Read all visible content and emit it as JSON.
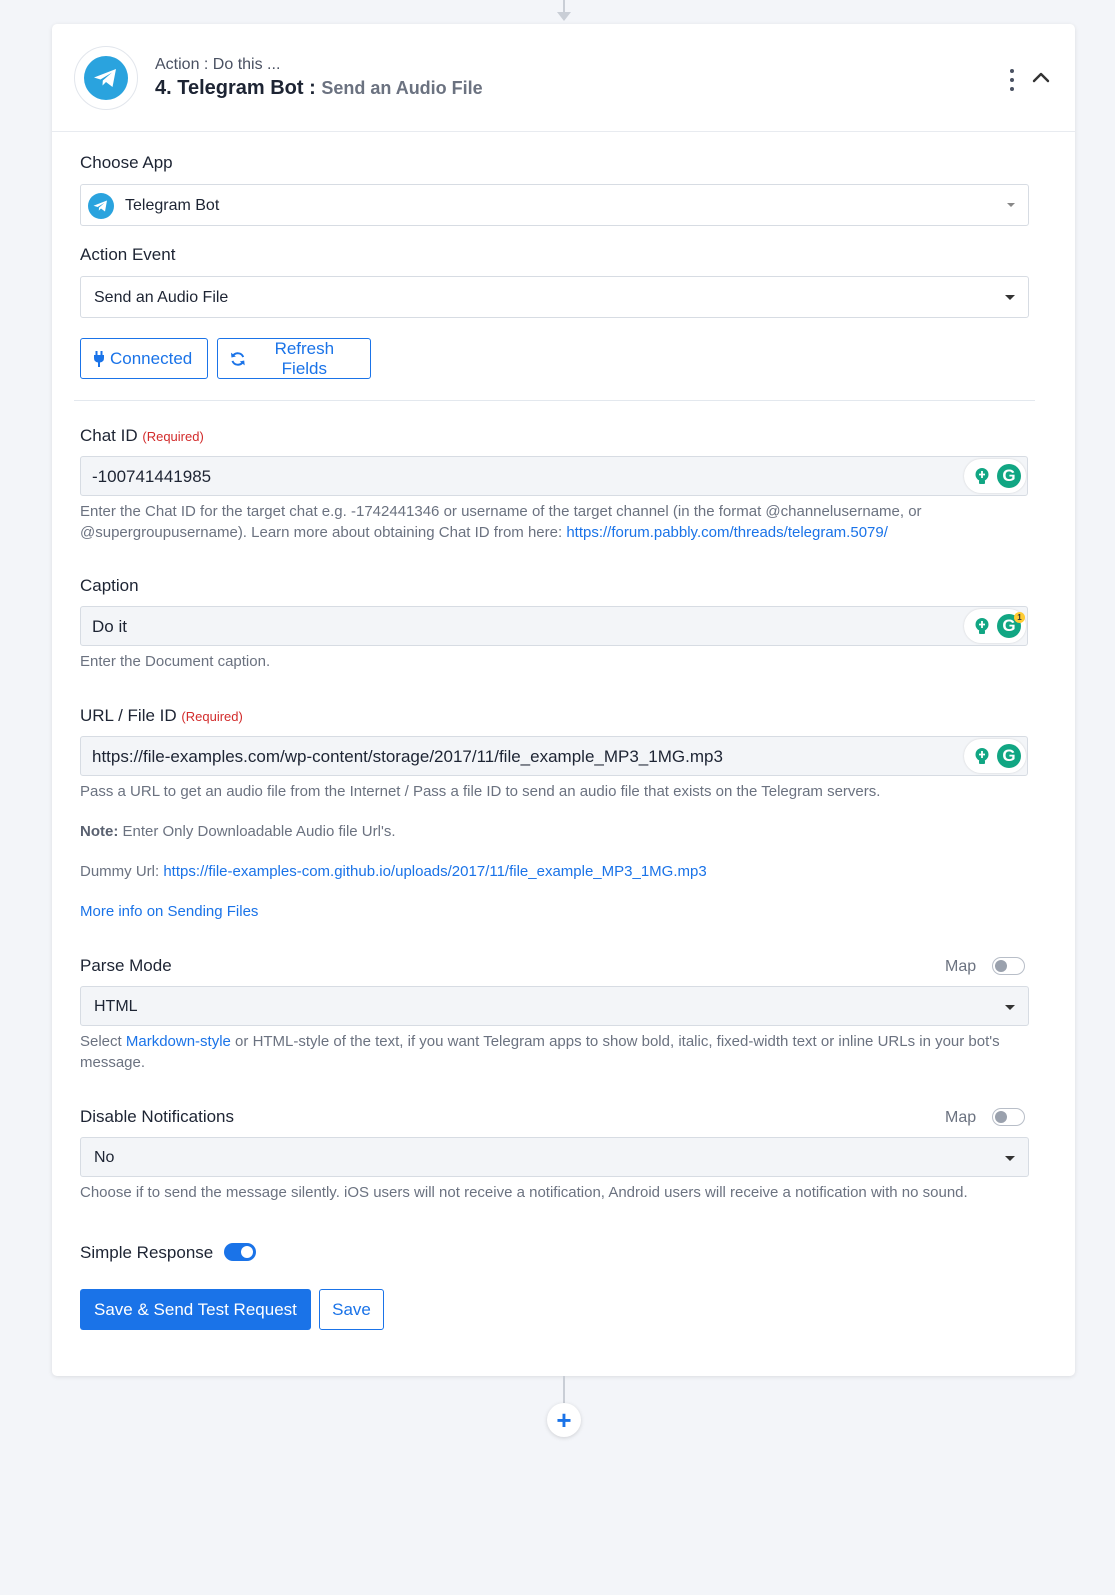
{
  "header": {
    "subtitle": "Action : Do this ...",
    "title": "4. Telegram Bot :",
    "event": "Send an Audio File"
  },
  "choose_app": {
    "label": "Choose App",
    "value": "Telegram Bot"
  },
  "action_event": {
    "label": "Action Event",
    "value": "Send an Audio File"
  },
  "buttons": {
    "connected": "Connected",
    "refresh": "Refresh Fields",
    "save_send": "Save & Send Test Request",
    "save": "Save"
  },
  "required_text": "(Required)",
  "chat_id": {
    "label": "Chat ID",
    "value": "-100741441985",
    "help_text": "Enter the Chat ID for the target chat e.g. -1742441346 or username of the target channel (in the format @channelusername, or @supergroupusername). Learn more about obtaining Chat ID from here: ",
    "help_link": "https://forum.pabbly.com/threads/telegram.5079/"
  },
  "caption": {
    "label": "Caption",
    "value": "Do it",
    "help": "Enter the Document caption.",
    "badge": "1"
  },
  "url_file": {
    "label": "URL / File ID",
    "value": "https://file-examples.com/wp-content/storage/2017/11/file_example_MP3_1MG.mp3",
    "help": "Pass a URL to get an audio file from the Internet / Pass a file ID to send an audio file that exists on the Telegram servers.",
    "note_label": "Note:",
    "note_text": " Enter Only Downloadable Audio file Url's.",
    "dummy_label": "Dummy Url: ",
    "dummy_link": "https://file-examples-com.github.io/uploads/2017/11/file_example_MP3_1MG.mp3",
    "more_info": "More info on Sending Files"
  },
  "parse_mode": {
    "label": "Parse Mode",
    "map_label": "Map",
    "value": "HTML",
    "help_pre": "Select ",
    "help_link": "Markdown-style",
    "help_post": " or HTML-style of the text, if you want Telegram apps to show bold, italic, fixed-width text or inline URLs in your bot's message."
  },
  "disable_notifications": {
    "label": "Disable Notifications",
    "map_label": "Map",
    "value": "No",
    "help": "Choose if to send the message silently. iOS users will not receive a notification, Android users will receive a notification with no sound."
  },
  "simple_response": {
    "label": "Simple Response",
    "enabled": true
  },
  "grammarly_letter": "G",
  "add_step_symbol": "+",
  "colors": {
    "accent": "#1a73e8",
    "telegram": "#2aa3de",
    "required": "#d22b2b",
    "grammarly": "#11a683"
  }
}
